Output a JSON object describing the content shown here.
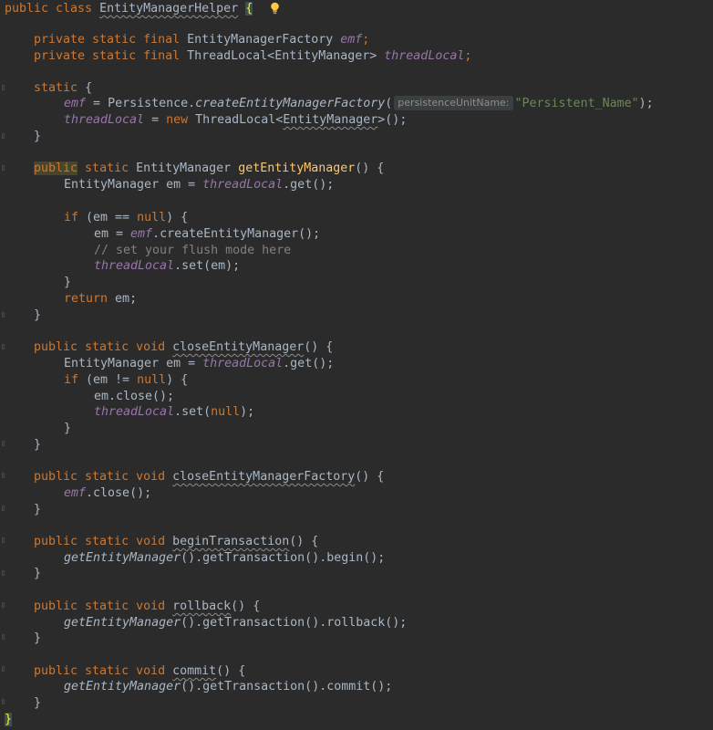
{
  "code": {
    "class_kw": "public class",
    "class_name": "EntityManagerHelper",
    "class_open": "{",
    "kw_private_static_final": "private static final",
    "emf_type": "EntityManagerFactory",
    "emf": "emf",
    "threadlocal_type": "ThreadLocal<EntityManager>",
    "threadLocal": "threadLocal",
    "semicolon": ";",
    "open_brace": "{",
    "close_brace": "}",
    "kw_static": "static",
    "eq": " = ",
    "persistence_call": "Persistence.",
    "create_emf": "createEntityManagerFactory",
    "paren_open": "(",
    "param_hint": "persistenceUnitName:",
    "unit_name": "\"Persistent_Name\"",
    "call_end": ");",
    "kw_new": "new",
    "threadlocal_ctor_a": "ThreadLocal<",
    "entity_manager": "EntityManager",
    "threadlocal_ctor_b": ">();",
    "kw_public": "public",
    "kw_static_sp": " static ",
    "return_type": "EntityManager",
    "get_em_name": "getEntityManager",
    "method_sig_end": "() {",
    "em_decl": "EntityManager em = ",
    "get_call": ".get();",
    "kw_if": "if",
    "cond_null": " (em == ",
    "kw_null": "null",
    "cond_end": ") {",
    "em_assign": "em = ",
    "create_em_call": ".createEntityManager();",
    "flush_comment": "// set your flush mode here",
    "set_em": ".set(em);",
    "kw_return": "return",
    "return_em": " em;",
    "kw_public_static_void": "public static void",
    "close_em_name": "closeEntityManager",
    "cond_not_null": " (em != ",
    "em_close": "em.close();",
    "set_open": ".set(",
    "paren_semicolon": ");",
    "close_emf_name": "closeEntityManagerFactory",
    "emf_close": ".close();",
    "begin_tx_name": "beginTransaction",
    "call_get_em": "getEntityManager",
    "begin_chain": "().getTransaction().begin();",
    "rollback_name": "rollback",
    "rollback_chain": "().getTransaction().rollback();",
    "commit_name": "commit",
    "commit_chain": "().getTransaction().commit();"
  },
  "colors": {
    "background": "#2b2b2b",
    "keyword": "#cc7832",
    "field": "#9876aa",
    "method_declaration": "#ffc66d",
    "string": "#6a8759",
    "comment": "#808080",
    "text": "#a9b7c6"
  },
  "icons": {
    "intention_bulb": "lightbulb-icon"
  }
}
